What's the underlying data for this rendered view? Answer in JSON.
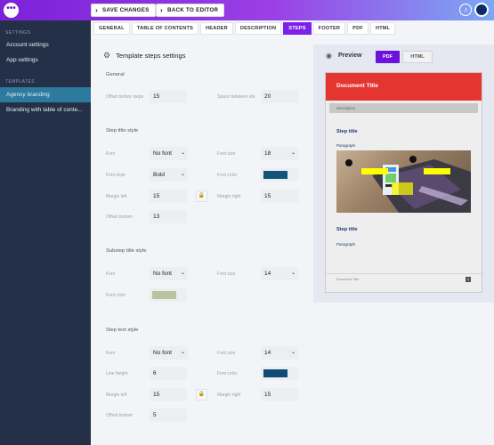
{
  "app": {
    "menu_icon": "more-horizontal-icon",
    "save_label": "SAVE CHANGES",
    "back_label": "BACK TO EDITOR"
  },
  "sidebar": {
    "settings_header": "SETTINGS",
    "settings_items": [
      "Account settings",
      "App settings"
    ],
    "templates_header": "TEMPLATES",
    "template_items": [
      "Agency branding",
      "Branding with table of conte..."
    ]
  },
  "tabs": [
    "GENERAL",
    "TABLE OF CONTENTS",
    "HEADER",
    "DESCRIPTION",
    "STEPS",
    "FOOTER",
    "PDF",
    "HTML"
  ],
  "active_tab": "STEPS",
  "form": {
    "page_title": "Template steps settings",
    "general": {
      "title": "General",
      "offset_before_steps_label": "Offset before steps",
      "offset_before_steps": "15",
      "space_between_label": "Space between ste",
      "space_between": "20"
    },
    "step_title_style": {
      "title": "Step title style",
      "font_label": "Font",
      "font": "No font",
      "font_size_label": "Font size",
      "font_size": "18",
      "font_style_label": "Font style",
      "font_style": "Bold",
      "font_color_label": "Font color",
      "font_color": "#11557a",
      "margin_left_label": "Margin left",
      "margin_left": "15",
      "margin_right_label": "Margin right",
      "margin_right": "15",
      "offset_bottom_label": "Offset bottom",
      "offset_bottom": "13"
    },
    "substep_title_style": {
      "title": "Substep title style",
      "font_label": "Font",
      "font": "No font",
      "font_size_label": "Font size",
      "font_size": "14",
      "font_color_label": "Font color",
      "font_color": "#bcc39f"
    },
    "step_text_style": {
      "title": "Step text style",
      "font_label": "Font",
      "font": "No font",
      "font_size_label": "Font size",
      "font_size": "14",
      "line_height_label": "Line height",
      "line_height": "6",
      "font_color_label": "Font color",
      "font_color": "#0e4c73",
      "margin_left_label": "Margin left",
      "margin_left": "15",
      "margin_right_label": "Margin right",
      "margin_right": "15",
      "offset_bottom_label": "Offset bottom",
      "offset_bottom": "5"
    }
  },
  "preview": {
    "title": "Preview",
    "pdf_label": "PDF",
    "html_label": "HTML",
    "doc_title": "Document Title",
    "description": "Description",
    "step1_title": "Step title",
    "step1_para": "Paragraph",
    "step2_title": "Step title",
    "step2_para": "Paragraph",
    "footer_text": "Document Title",
    "page_number": "1"
  }
}
